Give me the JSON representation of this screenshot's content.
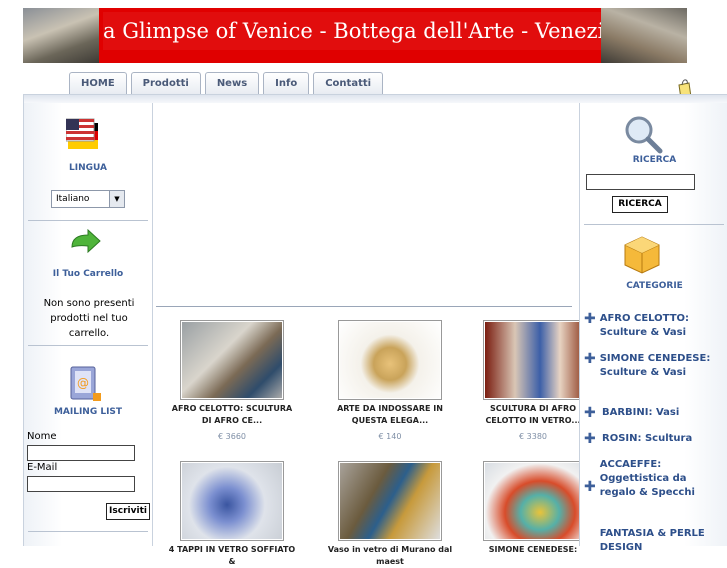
{
  "header": {
    "title": "a Glimpse of Venice - Bottega dell'Arte - Venezia"
  },
  "tabs": [
    "HOME",
    "Prodotti",
    "News",
    "Info",
    "Contatti"
  ],
  "left": {
    "language_title": "LINGUA",
    "language_value": "Italiano",
    "cart_title": "Il Tuo Carrello",
    "cart_msg": "Non sono presenti prodotti nel tuo carrello.",
    "mailing_title": "MAILING LIST",
    "name_label": "Nome",
    "email_label": "E-Mail",
    "subscribe": "Iscriviti"
  },
  "right": {
    "search_title": "RICERCA",
    "search_button": "RICERCA",
    "categories_title": "CATEGORIE",
    "categories": [
      "AFRO CELOTTO: Sculture & Vasi",
      "SIMONE CENEDESE: Sculture & Vasi",
      "BARBINI: Vasi",
      "ROSIN: Scultura",
      "ACCAEFFE: Oggettistica da regalo & Specchi",
      "FANTASIA & PERLE DESIGN"
    ]
  },
  "products": [
    {
      "name": "AFRO CELOTTO: SCULTURA DI AFRO CE...",
      "price": "€ 3660"
    },
    {
      "name": "ARTE DA INDOSSARE IN QUESTA ELEGA...",
      "price": "€ 140"
    },
    {
      "name": "SCULTURA DI AFRO CELOTTO IN VETRO...",
      "price": "€ 3380"
    },
    {
      "name": "4 TAPPI IN VETRO SOFFIATO &",
      "price": ""
    },
    {
      "name": "Vaso in vetro di Murano dal maest",
      "price": ""
    },
    {
      "name": "SIMONE CENEDESE:",
      "price": ""
    }
  ],
  "colors": {
    "header_bg": "#e00000",
    "link": "#2d4f8a",
    "title": "#3d5f9a"
  },
  "icons": [
    "flag-icon",
    "cart-arrow-icon",
    "mailbook-icon",
    "magnifier-icon",
    "box-icon",
    "plus-icon",
    "shopping-bag-icon"
  ]
}
